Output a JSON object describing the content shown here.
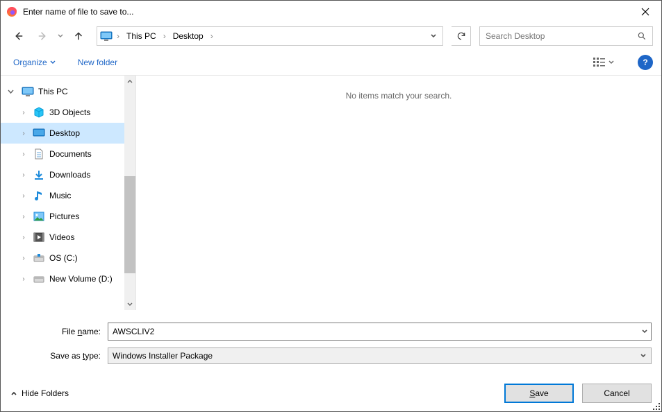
{
  "title": "Enter name of file to save to...",
  "breadcrumb": {
    "seg1": "This PC",
    "seg2": "Desktop"
  },
  "search": {
    "placeholder": "Search Desktop"
  },
  "toolbar": {
    "organize": "Organize",
    "newfolder": "New folder"
  },
  "tree": {
    "root": "This PC",
    "items": [
      {
        "label": "3D Objects",
        "icon": "3d"
      },
      {
        "label": "Desktop",
        "icon": "desktop",
        "selected": true
      },
      {
        "label": "Documents",
        "icon": "documents"
      },
      {
        "label": "Downloads",
        "icon": "downloads"
      },
      {
        "label": "Music",
        "icon": "music"
      },
      {
        "label": "Pictures",
        "icon": "pictures"
      },
      {
        "label": "Videos",
        "icon": "videos"
      },
      {
        "label": "OS (C:)",
        "icon": "drive"
      },
      {
        "label": "New Volume (D:)",
        "icon": "drive"
      }
    ]
  },
  "content": {
    "empty": "No items match your search."
  },
  "form": {
    "filename_label_pre": "File ",
    "filename_label_u": "n",
    "filename_label_post": "ame:",
    "filename_value": "AWSCLIV2",
    "type_label_pre": "Save as ",
    "type_label_u": "t",
    "type_label_post": "ype:",
    "type_value": "Windows Installer Package"
  },
  "footer": {
    "hide": "Hide Folders",
    "save_pre": "",
    "save_u": "S",
    "save_post": "ave",
    "cancel": "Cancel"
  }
}
